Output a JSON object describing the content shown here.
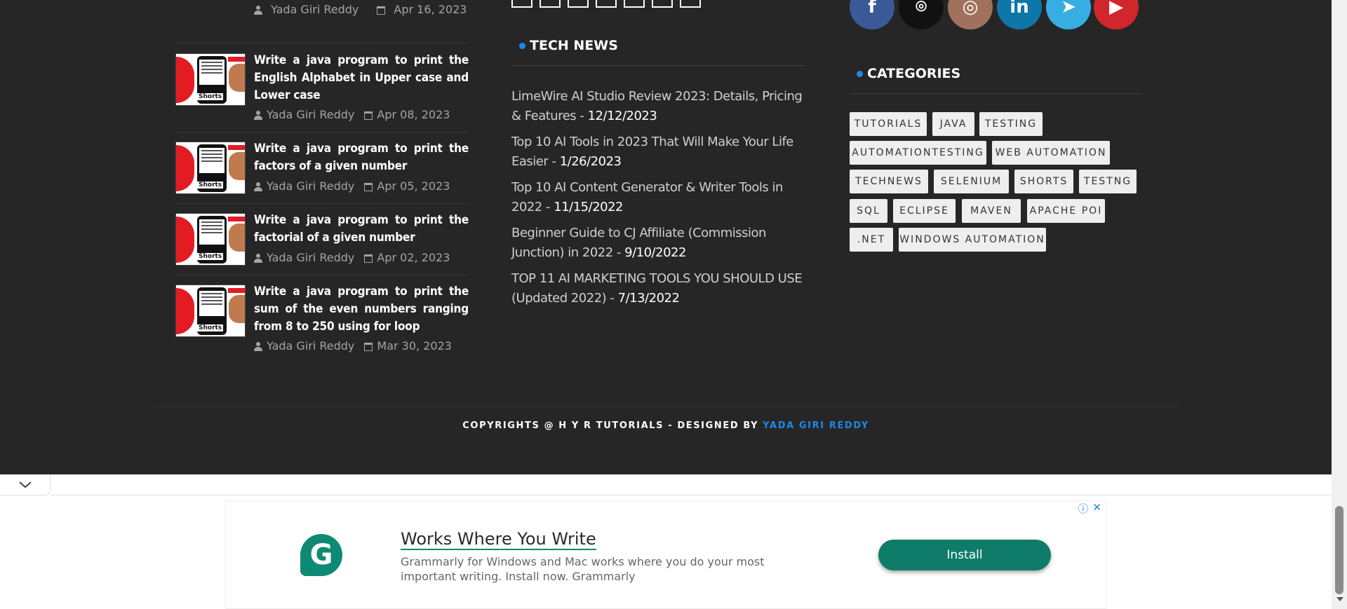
{
  "left_column": {
    "top_meta": {
      "author": "Yada Giri Reddy",
      "date": "Apr 16, 2023"
    },
    "posts": [
      {
        "title": "Write a java program to print the English Alphabet in Upper case and Lower case",
        "author": "Yada Giri Reddy",
        "date": "Apr 08, 2023"
      },
      {
        "title": "Write a java program to print the factors of a given number",
        "author": "Yada Giri Reddy",
        "date": "Apr 05, 2023"
      },
      {
        "title": "Write a java program to print the factorial of a given number",
        "author": "Yada Giri Reddy",
        "date": "Apr 02, 2023"
      },
      {
        "title": "Write a java program to print the sum of the even numbers ranging from 8 to 250 using for loop",
        "author": "Yada Giri Reddy",
        "date": "Mar 30, 2023"
      }
    ],
    "thumb_badge": "Shorts"
  },
  "tech_news": {
    "heading": "TECH NEWS",
    "items": [
      {
        "title": "LimeWire AI Studio Review 2023: Details, Pricing & Features - ",
        "date": "12/12/2023"
      },
      {
        "title": "Top 10 AI Tools in 2023 That Will Make Your Life Easier - ",
        "date": "1/26/2023"
      },
      {
        "title": "Top 10 AI Content Generator & Writer Tools in 2022 - ",
        "date": "11/15/2022"
      },
      {
        "title": "Beginner Guide to CJ Affiliate (Commission Junction) in 2022 - ",
        "date": "9/10/2022"
      },
      {
        "title": "TOP 11 AI MARKETING TOOLS YOU SHOULD USE (Updated 2022) - ",
        "date": "7/13/2022"
      }
    ]
  },
  "social": [
    {
      "icon": "facebook-icon",
      "glyph": "f",
      "color": "#3b5998"
    },
    {
      "icon": "github-icon",
      "glyph": "⌾",
      "color": "#111111"
    },
    {
      "icon": "instagram-icon",
      "glyph": "◎",
      "color": "#a0725d"
    },
    {
      "icon": "linkedin-icon",
      "glyph": "in",
      "color": "#0e76a8"
    },
    {
      "icon": "telegram-icon",
      "glyph": "➤",
      "color": "#37aee2"
    },
    {
      "icon": "youtube-icon",
      "glyph": "▶",
      "color": "#d1262b"
    }
  ],
  "categories": {
    "heading": "CATEGORIES",
    "tags": [
      "Tutorials",
      "Java",
      "Testing",
      "AutomationTesting",
      "Web Automation",
      "TechNews",
      "Selenium",
      "Shorts",
      "TestNG",
      "SQL",
      "Eclipse",
      "Maven",
      "Apache POI",
      ".Net",
      "Windows Automation"
    ]
  },
  "footer": {
    "copyright_prefix": "COPYRIGHTS @ H Y R TUTORIALS - DESIGNED BY ",
    "designer_link": "YADA GIRI REDDY"
  },
  "ad": {
    "logo_letter": "G",
    "headline": "Works Where You Write",
    "body": "Grammarly for Windows and Mac works where you do your most important writing. Install now. Grammarly",
    "cta": "Install",
    "info_glyph": "ⓘ",
    "close_glyph": "✕",
    "toggle_glyph": "⌄"
  },
  "colors": {
    "accent": "#1e88e5",
    "background": "#262626",
    "ad_green": "#0e7c68"
  }
}
